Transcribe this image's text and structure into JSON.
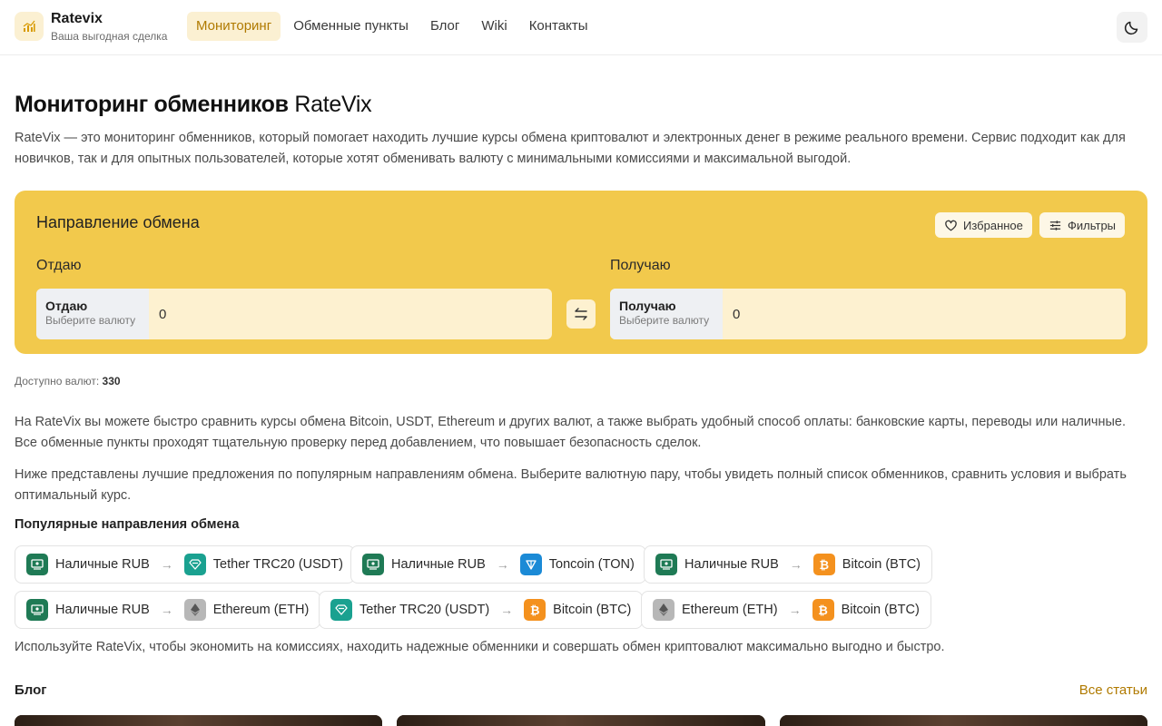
{
  "header": {
    "brand_name": "Ratevix",
    "brand_tagline": "Ваша выгодная сделка",
    "nav": [
      {
        "label": "Мониторинг",
        "active": true
      },
      {
        "label": "Обменные пункты",
        "active": false
      },
      {
        "label": "Блог",
        "active": false
      },
      {
        "label": "Wiki",
        "active": false
      },
      {
        "label": "Контакты",
        "active": false
      }
    ],
    "theme_icon": "moon-icon"
  },
  "main": {
    "title_bold": "Мониторинг обменников",
    "title_accent": "RateVix",
    "intro": "RateVix — это мониторинг обменников, который помогает находить лучшие курсы обмена криптовалют и электронных денег в режиме реального времени. Сервис подходит как для новичков, так и для опытных пользователей, которые хотят обменивать валюту с минимальными комиссиями и максимальной выгодой."
  },
  "exchange": {
    "title": "Направление обмена",
    "favorites_label": "Избранное",
    "filters_label": "Фильтры",
    "give": {
      "section_label": "Отдаю",
      "field_title": "Отдаю",
      "field_hint": "Выберите валюту",
      "amount": "0"
    },
    "get": {
      "section_label": "Получаю",
      "field_title": "Получаю",
      "field_hint": "Выберите валюту",
      "amount": "0"
    },
    "card_color": "#f2c94c"
  },
  "available": {
    "label": "Доступно валют:",
    "count": "330"
  },
  "paragraphs": {
    "p1": "На RateVix вы можете быстро сравнить курсы обмена Bitcoin, USDT, Ethereum и других валют, а также выбрать удобный способ оплаты: банковские карты, переводы или наличные. Все обменные пункты проходят тщательную проверку перед добавлением, что повышает безопасность сделок.",
    "p2": "Ниже представлены лучшие предложения по популярным направлениям обмена. Выберите валютную пару, чтобы увидеть полный список обменников, сравнить условия и выбрать оптимальный курс."
  },
  "popular": {
    "title": "Популярные направления обмена",
    "pairs": [
      {
        "from": "Наличные RUB",
        "from_icon": "cash-rub-icon",
        "to": "Tether TRC20 (USDT)",
        "to_icon": "tether-icon"
      },
      {
        "from": "Наличные RUB",
        "from_icon": "cash-rub-icon",
        "to": "Toncoin (TON)",
        "to_icon": "toncoin-icon"
      },
      {
        "from": "Наличные RUB",
        "from_icon": "cash-rub-icon",
        "to": "Bitcoin (BTC)",
        "to_icon": "bitcoin-icon"
      },
      {
        "from": "Наличные RUB",
        "from_icon": "cash-rub-icon",
        "to": "Ethereum (ETH)",
        "to_icon": "ethereum-icon"
      },
      {
        "from": "Tether TRC20 (USDT)",
        "from_icon": "tether-icon",
        "to": "Bitcoin (BTC)",
        "to_icon": "bitcoin-icon"
      },
      {
        "from": "Ethereum (ETH)",
        "from_icon": "ethereum-icon",
        "to": "Bitcoin (BTC)",
        "to_icon": "bitcoin-icon"
      }
    ]
  },
  "closing": "Используйте RateVix, чтобы экономить на комиссиях, находить надежные обменники и совершать обмен криптовалют максимально выгодно и быстро.",
  "blog": {
    "title": "Блог",
    "all_label": "Все статьи"
  }
}
